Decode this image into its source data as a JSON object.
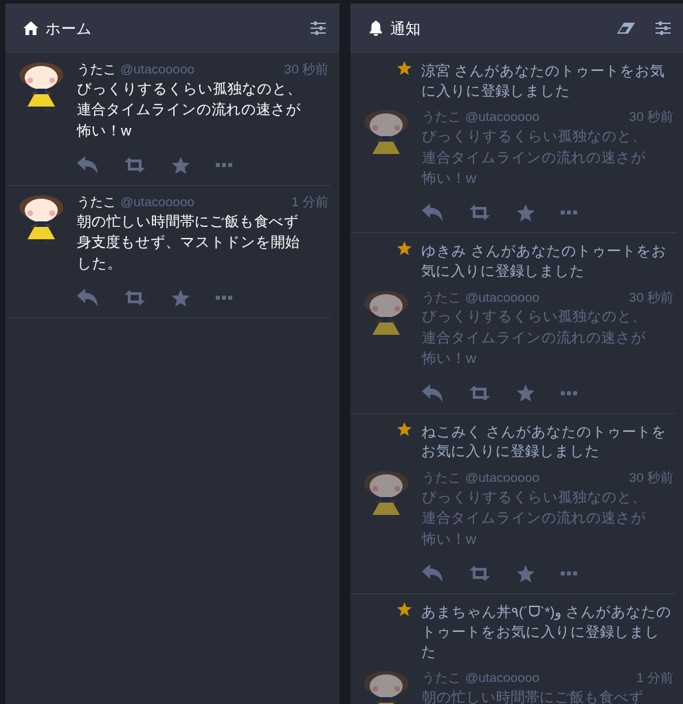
{
  "columns": [
    {
      "kind": "home",
      "title": "ホーム",
      "clear_button": false,
      "items": [
        {
          "kind": "status",
          "status": {
            "display_name": "うたこ",
            "acct": "@utacooooo",
            "time": "30 秒前",
            "content": "びっくりするくらい孤独なのと、連合タイムラインの流れの速さが怖い！w",
            "show_actions": true
          }
        },
        {
          "kind": "status",
          "status": {
            "display_name": "うたこ",
            "acct": "@utacooooo",
            "time": "1 分前",
            "content": "朝の忙しい時間帯にご飯も食べず身支度もせず、マストドンを開始した。",
            "show_actions": true
          }
        }
      ]
    },
    {
      "kind": "notifications",
      "title": "通知",
      "clear_button": true,
      "items": [
        {
          "kind": "favourite",
          "message": "涼宮 さんがあなたのトゥートをお気に入りに登録しました",
          "status": {
            "display_name": "うたこ",
            "acct": "@utacooooo",
            "time": "30 秒前",
            "content": "びっくりするくらい孤独なのと、連合タイムラインの流れの速さが怖い！w",
            "show_actions": true
          }
        },
        {
          "kind": "favourite",
          "message": "ゆきみ さんがあなたのトゥートをお気に入りに登録しました",
          "status": {
            "display_name": "うたこ",
            "acct": "@utacooooo",
            "time": "30 秒前",
            "content": "びっくりするくらい孤独なのと、連合タイムラインの流れの速さが怖い！w",
            "show_actions": true
          }
        },
        {
          "kind": "favourite",
          "message": "ねこみく さんがあなたのトゥートをお気に入りに登録しました",
          "status": {
            "display_name": "うたこ",
            "acct": "@utacooooo",
            "time": "30 秒前",
            "content": "びっくりするくらい孤独なのと、連合タイムラインの流れの速さが怖い！w",
            "show_actions": true
          }
        },
        {
          "kind": "favourite",
          "message": "あまちゃん丼٩(´ᗜ`*)و さんがあなたのトゥートをお気に入りに登録しました",
          "status": {
            "display_name": "うたこ",
            "acct": "@utacooooo",
            "time": "1 分前",
            "content": "朝の忙しい時間帯にご飯も食べず",
            "show_actions": false
          }
        }
      ]
    }
  ]
}
